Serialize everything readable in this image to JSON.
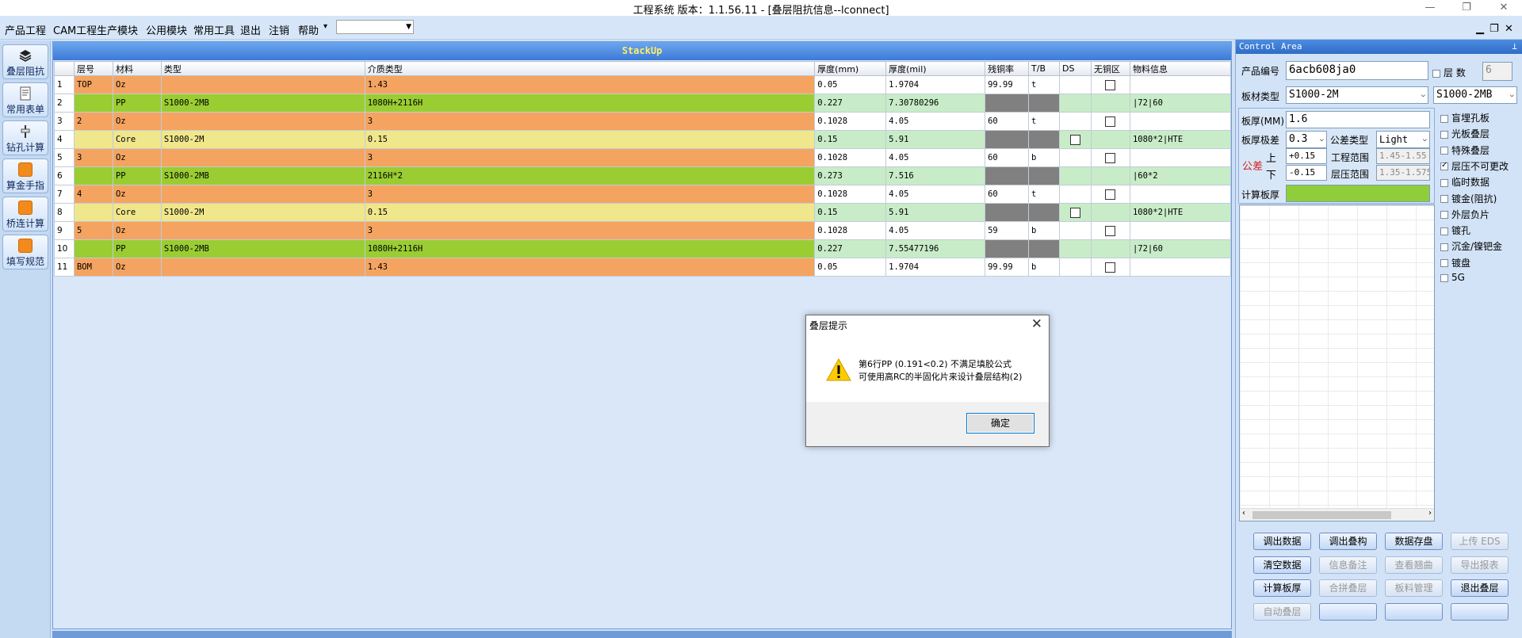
{
  "window": {
    "title": "工程系统   版本：1.1.56.11 - [叠层阻抗信息--lconnect]",
    "min": "—",
    "max": "❐",
    "close": "✕"
  },
  "menu": {
    "items": [
      "产品工程",
      "CAM工程",
      "生产模块",
      "公用模块",
      "常用工具",
      "退出",
      "注销",
      "帮助"
    ],
    "mdi": {
      "min": "▁",
      "restore": "❐",
      "close": "✕"
    }
  },
  "leftbar": {
    "buttons": [
      "叠层阻抗",
      "常用表单",
      "钻孔计算",
      "算金手指",
      "桥连计算",
      "填写规范"
    ]
  },
  "grid": {
    "title": "StackUp",
    "headers": [
      "",
      "层号",
      "材料",
      "类型",
      "介质类型",
      "厚度(mm)",
      "厚度(mil)",
      "残铜率",
      "T/B",
      "DS",
      "无铜区",
      "物料信息"
    ],
    "rows": [
      {
        "n": "1",
        "layer": "TOP",
        "mat": "Oz",
        "type": "",
        "diel": "1.43",
        "mm": "0.05",
        "mil": "1.9704",
        "cu": "99.99",
        "tb": "t",
        "ds": "",
        "nocu": true,
        "info": "",
        "style": "or"
      },
      {
        "n": "2",
        "layer": "",
        "mat": "PP",
        "type": "S1000-2MB",
        "diel": "1080H+2116H",
        "mm": "0.227",
        "mil": "7.30780296",
        "cu": "",
        "tb": "",
        "ds": "",
        "nocu": false,
        "info": "|72|60",
        "style": "gr"
      },
      {
        "n": "3",
        "layer": "2",
        "mat": "Oz",
        "type": "",
        "diel": "3",
        "mm": "0.1028",
        "mil": "4.05",
        "cu": "60",
        "tb": "t",
        "ds": "",
        "nocu": true,
        "info": "",
        "style": "or"
      },
      {
        "n": "4",
        "layer": "",
        "mat": "Core",
        "type": "S1000-2M",
        "diel": "0.15",
        "mm": "0.15",
        "mil": "5.91",
        "cu": "",
        "tb": "",
        "ds": "box",
        "nocu": false,
        "info": "1080*2|HTE",
        "style": "ye"
      },
      {
        "n": "5",
        "layer": "3",
        "mat": "Oz",
        "type": "",
        "diel": "3",
        "mm": "0.1028",
        "mil": "4.05",
        "cu": "60",
        "tb": "b",
        "ds": "",
        "nocu": true,
        "info": "",
        "style": "or"
      },
      {
        "n": "6",
        "layer": "",
        "mat": "PP",
        "type": "S1000-2MB",
        "diel": "2116H*2",
        "mm": "0.273",
        "mil": "7.516",
        "cu": "",
        "tb": "",
        "ds": "",
        "nocu": false,
        "info": "|60*2",
        "style": "gr"
      },
      {
        "n": "7",
        "layer": "4",
        "mat": "Oz",
        "type": "",
        "diel": "3",
        "mm": "0.1028",
        "mil": "4.05",
        "cu": "60",
        "tb": "t",
        "ds": "",
        "nocu": true,
        "info": "",
        "style": "or"
      },
      {
        "n": "8",
        "layer": "",
        "mat": "Core",
        "type": "S1000-2M",
        "diel": "0.15",
        "mm": "0.15",
        "mil": "5.91",
        "cu": "",
        "tb": "",
        "ds": "box",
        "nocu": false,
        "info": "1080*2|HTE",
        "style": "ye"
      },
      {
        "n": "9",
        "layer": "5",
        "mat": "Oz",
        "type": "",
        "diel": "3",
        "mm": "0.1028",
        "mil": "4.05",
        "cu": "59",
        "tb": "b",
        "ds": "",
        "nocu": true,
        "info": "",
        "style": "or"
      },
      {
        "n": "10",
        "layer": "",
        "mat": "PP",
        "type": "S1000-2MB",
        "diel": "1080H+2116H",
        "mm": "0.227",
        "mil": "7.55477196",
        "cu": "",
        "tb": "",
        "ds": "",
        "nocu": false,
        "info": "|72|60",
        "style": "gr"
      },
      {
        "n": "11",
        "layer": "BOM",
        "mat": "Oz",
        "type": "",
        "diel": "1.43",
        "mm": "0.05",
        "mil": "1.9704",
        "cu": "99.99",
        "tb": "b",
        "ds": "",
        "nocu": true,
        "info": "",
        "style": "or"
      }
    ]
  },
  "control": {
    "title": "Control Area",
    "pin": "⊥",
    "product_no_label": "产品编号",
    "product_no": "6acb608ja0",
    "layer_label": "层  数",
    "layer_count": "6",
    "board_type_label": "板材类型",
    "board_type": "S1000-2M",
    "board_type2": "S1000-2MB",
    "thickness_label": "板厚(MM)",
    "thickness": "1.6",
    "tol_label": "板厚极差",
    "tol": "0.3",
    "tol_type_label": "公差类型",
    "tol_type": "Light",
    "gongcha": "公差",
    "up_label": "上",
    "down_label": "下",
    "up": "+0.15",
    "down": "-0.15",
    "eng_range_label": "工程范围",
    "eng_range": "1.45-1.55",
    "press_range_label": "层压范围",
    "press_range": "1.35-1.575",
    "calc_label": "计算板厚",
    "options": [
      "盲埋孔板",
      "光板叠层",
      "特殊叠层",
      "层压不可更改",
      "临时数据",
      "镀金(阻抗)",
      "外层负片",
      "镀孔",
      "沉金/镍钯金",
      "镀盘",
      "5G"
    ],
    "buttons": [
      [
        "调出数据",
        "调出叠构",
        "数据存盘",
        "上传 EDS"
      ],
      [
        "清空数据",
        "信息备注",
        "查看翘曲",
        "导出报表"
      ],
      [
        "计算板厚",
        "合拼叠层",
        "板料管理",
        "退出叠层"
      ],
      [
        "自动叠层",
        "",
        "",
        ""
      ]
    ]
  },
  "dialog": {
    "title": "叠层提示",
    "close": "✕",
    "line1": "第6行PP (0.191<0.2) 不满足填胶公式",
    "line2": "可使用高RC的半固化片来设计叠层结构(2)",
    "ok": "确定"
  },
  "colors": {
    "copper": "#f4a460",
    "pp": "#9acd32",
    "core": "#f0e68c",
    "panel_header": "#3c7ad8"
  }
}
